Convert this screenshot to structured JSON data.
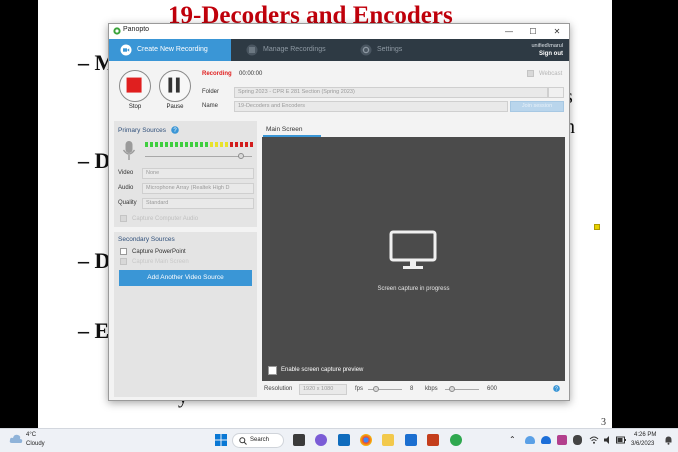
{
  "slide": {
    "title": "19-Decoders and Encoders",
    "bullet_fragments": [
      "– M",
      "– D",
      "– D",
      "– E"
    ],
    "right_fragments": [
      "s",
      "n"
    ],
    "bottom_fragment": "y",
    "page_number": "3"
  },
  "window": {
    "app_title": "Panopto",
    "controls": {
      "minimize": "—",
      "maximize": "☐",
      "close": "✕"
    },
    "nav": {
      "tabs": [
        {
          "label": "Create New Recording",
          "icon": "video-camera-icon",
          "active": true
        },
        {
          "label": "Manage Recordings",
          "icon": "list-icon",
          "active": false
        },
        {
          "label": "Settings",
          "icon": "gear-icon",
          "active": false
        }
      ],
      "user": "unified\\marul",
      "sign_out": "Sign out"
    },
    "recording": {
      "stop_label": "Stop",
      "pause_label": "Pause",
      "status_label": "Recording",
      "elapsed": "00:00:00",
      "webcast_label": "Webcast",
      "folder_label": "Folder",
      "folder_value": "Spring 2023 - CPR E 281 Section (Spring 2023)",
      "name_label": "Name",
      "name_value": "19-Decoders and Encoders",
      "join_button": "Join session"
    },
    "primary_sources": {
      "title": "Primary Sources",
      "video_label": "Video",
      "video_value": "None",
      "audio_label": "Audio",
      "audio_value": "Microphone Array (Realtek High D",
      "quality_label": "Quality",
      "quality_value": "Standard",
      "capture_computer_audio": "Capture Computer Audio",
      "volume_level": 0.9,
      "meter_segments": 22,
      "meter_colors": {
        "green": "#3fcf3f",
        "yellow": "#e8e22a",
        "red": "#d31d1d"
      }
    },
    "secondary_sources": {
      "title": "Secondary Sources",
      "capture_powerpoint": "Capture PowerPoint",
      "capture_main_screen": "Capture Main Screen",
      "add_video_button": "Add Another Video Source"
    },
    "preview": {
      "tab": "Main Screen",
      "message": "Screen capture in progress",
      "enable_preview": "Enable screen capture preview",
      "resolution_label": "Resolution",
      "resolution_value": "1920 x 1080",
      "fps_label": "fps",
      "fps_value": "8",
      "kbps_label": "kbps",
      "kbps_value": "600"
    },
    "colors": {
      "accent": "#3a96d6",
      "nav_bg": "#2e3a44",
      "stop_red": "#e01f1f"
    }
  },
  "taskbar": {
    "weather_temp": "4°C",
    "weather_desc": "Cloudy",
    "search_label": "Search",
    "time": "4:26 PM",
    "date": "3/6/2023"
  }
}
